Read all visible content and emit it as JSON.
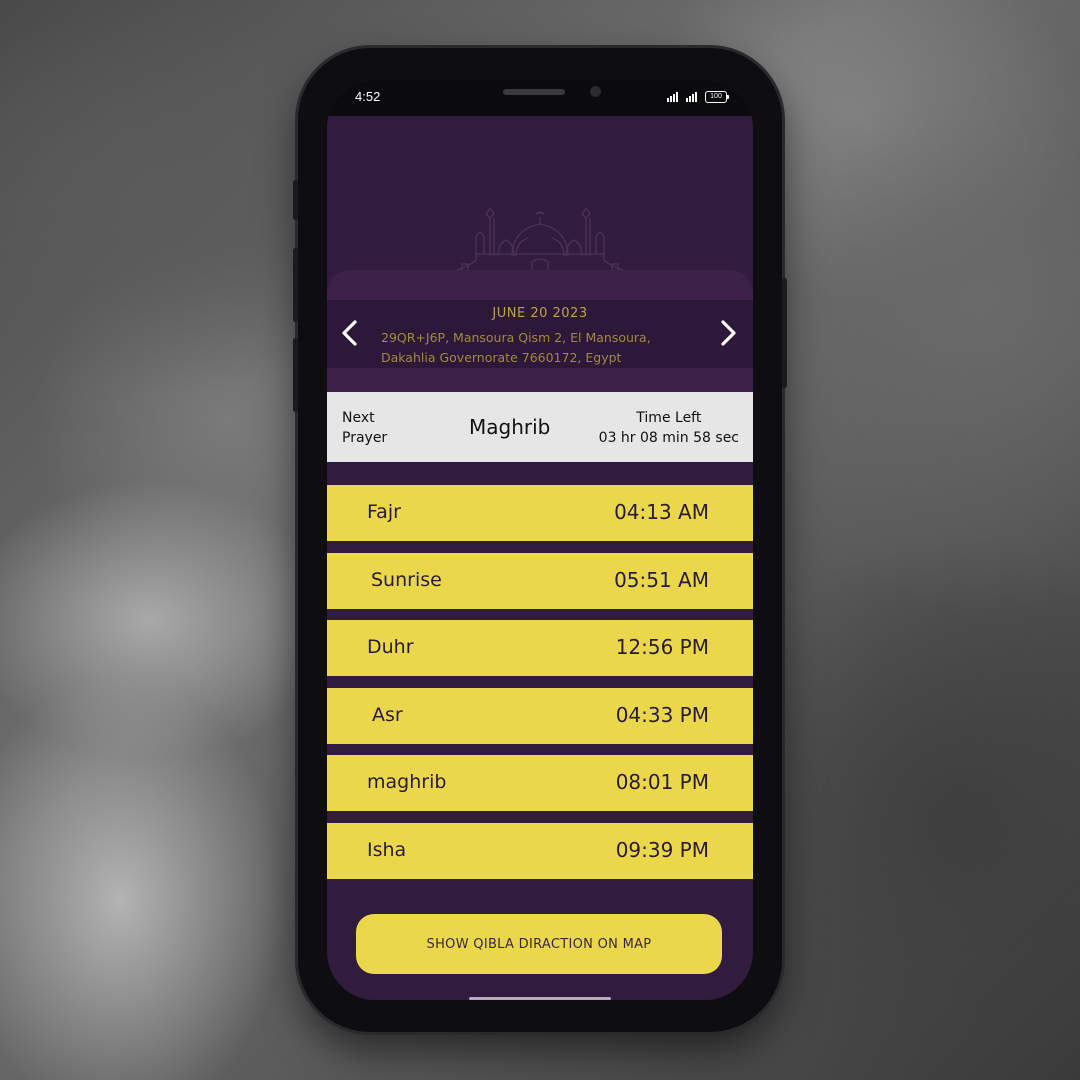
{
  "status_bar": {
    "time": "4:52",
    "battery": "100"
  },
  "location": {
    "date": "JUNE 20 2023",
    "address_line1": "29QR+J6P, Mansoura Qism 2, El Mansoura,",
    "address_line2": "Dakahlia Governorate 7660172, Egypt",
    "prev_icon": "chevron-left-icon",
    "next_icon": "chevron-right-icon"
  },
  "next_prayer": {
    "label_line1": "Next",
    "label_line2": "Prayer",
    "name": "Maghrib",
    "time_left_label": "Time Left",
    "time_left_value": "03 hr 08 min 58 sec"
  },
  "prayers": [
    {
      "name": "Fajr",
      "time": "04:13 AM"
    },
    {
      "name": "Sunrise",
      "time": "05:51 AM"
    },
    {
      "name": "Duhr",
      "time": "12:56 PM"
    },
    {
      "name": "Asr",
      "time": "04:33 PM"
    },
    {
      "name": "maghrib",
      "time": "08:01 PM"
    },
    {
      "name": "Isha",
      "time": "09:39 PM"
    }
  ],
  "qibla_button": {
    "label": "SHOW QIBLA DIRACTION ON MAP"
  },
  "colors": {
    "background": "#321c3e",
    "card": "#ead84a",
    "accent_text": "#bda24a",
    "banner": "#e6e6e6"
  }
}
